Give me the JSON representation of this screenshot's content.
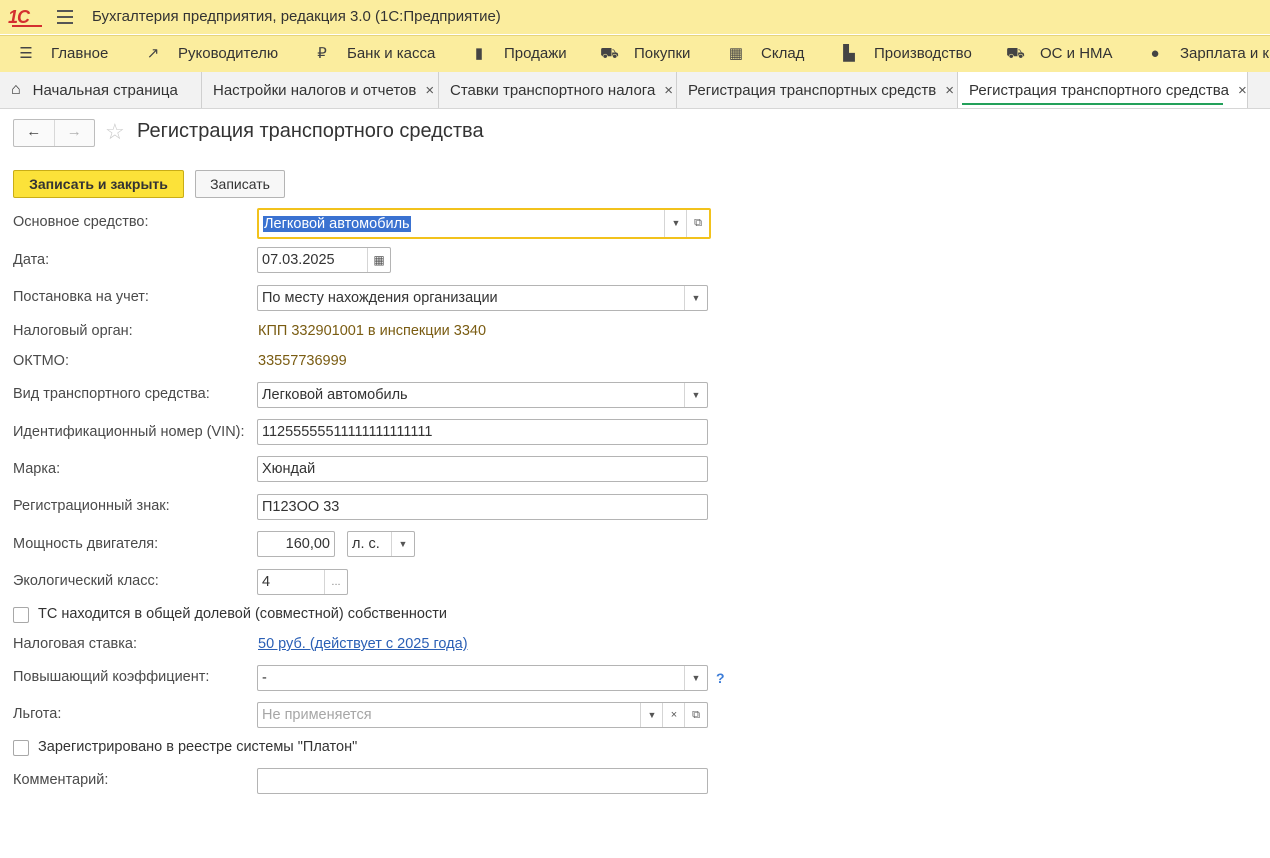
{
  "app": {
    "logo": "1С",
    "title": "Бухгалтерия предприятия, редакция 3.0  (1С:Предприятие)"
  },
  "sections": [
    {
      "label": "Главное",
      "icon": "menu-icon"
    },
    {
      "label": "Руководителю",
      "icon": "trend-icon"
    },
    {
      "label": "Банк и касса",
      "icon": "ruble-icon"
    },
    {
      "label": "Продажи",
      "icon": "bag-icon"
    },
    {
      "label": "Покупки",
      "icon": "cart-icon"
    },
    {
      "label": "Склад",
      "icon": "warehouse-icon"
    },
    {
      "label": "Производство",
      "icon": "factory-icon"
    },
    {
      "label": "ОС и НМА",
      "icon": "truck-icon"
    },
    {
      "label": "Зарплата и ка",
      "icon": "person-icon"
    }
  ],
  "tabs": [
    {
      "label": "Начальная страница",
      "icon": "home-icon"
    },
    {
      "label": "Настройки налогов и отчетов",
      "close": "×"
    },
    {
      "label": "Ставки транспортного налога",
      "close": "×"
    },
    {
      "label": "Регистрация транспортных средств",
      "close": "×"
    },
    {
      "label": "Регистрация транспортного средства",
      "close": "×",
      "active": true
    }
  ],
  "form": {
    "title": "Регистрация транспортного средства",
    "save_close_label": "Записать и закрыть",
    "save_label": "Записать",
    "fields": {
      "asset": {
        "label": "Основное средство:",
        "value": "Легковой автомобиль"
      },
      "date": {
        "label": "Дата:",
        "value": "07.03.2025"
      },
      "registration": {
        "label": "Постановка на учет:",
        "value": "По месту нахождения организации"
      },
      "tax_authority": {
        "label": "Налоговый орган:",
        "value": "КПП 332901001 в инспекции 3340"
      },
      "oktmo": {
        "label": "ОКТМО:",
        "value": "33557736999"
      },
      "vehicle_type": {
        "label": "Вид транспортного средства:",
        "value": "Легковой автомобиль"
      },
      "vin": {
        "label": "Идентификационный номер (VIN):",
        "value": "11255555511111111111111"
      },
      "brand": {
        "label": "Марка:",
        "value": "Хюндай"
      },
      "reg_plate": {
        "label": "Регистрационный знак:",
        "value": "П123ОО 33"
      },
      "engine_power": {
        "label": "Мощность двигателя:",
        "value": "160,00",
        "unit": "л. с."
      },
      "eco_class": {
        "label": "Экологический класс:",
        "value": "4",
        "button": "..."
      },
      "shared_ownership": {
        "label": "ТС находится в общей долевой (совместной) собственности",
        "checked": false
      },
      "tax_rate": {
        "label": "Налоговая ставка:",
        "value": "50 руб. (действует с 2025 года)"
      },
      "coefficient": {
        "label": "Повышающий коэффициент:",
        "value": "-",
        "help": "?"
      },
      "benefit": {
        "label": "Льгота:",
        "placeholder": "Не применяется"
      },
      "platon": {
        "label": "Зарегистрировано в реестре системы \"Платон\"",
        "checked": false
      },
      "comment": {
        "label": "Комментарий:",
        "value": ""
      }
    }
  },
  "colors": {
    "header_bg": "#fbed9e",
    "primary_button": "#fce239",
    "info_text": "#7a5c12",
    "link": "#2a5fb5",
    "active_tab_underline": "#23a05a"
  }
}
